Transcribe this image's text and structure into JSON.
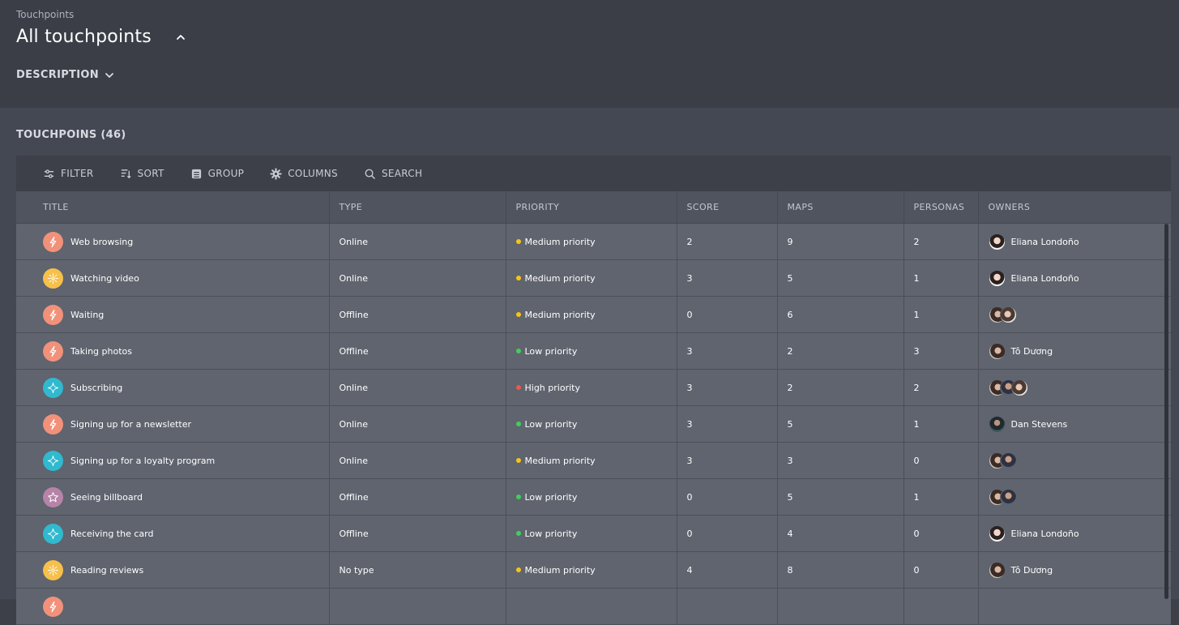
{
  "header": {
    "breadcrumb": "Touchpoints",
    "title": "All touchpoints",
    "description_label": "DESCRIPTION"
  },
  "section": {
    "title": "TOUCHPOINS (46)"
  },
  "toolbar": {
    "filter": "FILTER",
    "sort": "SORT",
    "group": "GROUP",
    "columns": "COLUMNS",
    "search": "SEARCH"
  },
  "columns": [
    "TITLE",
    "TYPE",
    "PRIORITY",
    "SCORE",
    "MAPS",
    "PERSONAS",
    "OWNERS"
  ],
  "priority_colors": {
    "Medium priority": "#f5c518",
    "Low priority": "#3fcf5b",
    "High priority": "#f0544f"
  },
  "icon_colors": {
    "lightning-icon": "#f2917a",
    "radial-icon": "#f7c04b",
    "sparkle-icon": "#30b9cf",
    "star-icon": "#b584a8"
  },
  "rows": [
    {
      "title": "Web browsing",
      "icon": "lightning-icon",
      "type": "Online",
      "priority": "Medium priority",
      "score": "2",
      "maps": "9",
      "personas": "2",
      "owners": [
        "avatar-a"
      ],
      "owner_name": "Eliana Londoño"
    },
    {
      "title": "Watching video",
      "icon": "radial-icon",
      "type": "Online",
      "priority": "Medium priority",
      "score": "3",
      "maps": "5",
      "personas": "1",
      "owners": [
        "avatar-a"
      ],
      "owner_name": "Eliana Londoño"
    },
    {
      "title": "Waiting",
      "icon": "lightning-icon",
      "type": "Offline",
      "priority": "Medium priority",
      "score": "0",
      "maps": "6",
      "personas": "1",
      "owners": [
        "avatar-b",
        "avatar-c"
      ],
      "owner_name": ""
    },
    {
      "title": "Taking photos",
      "icon": "lightning-icon",
      "type": "Offline",
      "priority": "Low priority",
      "score": "3",
      "maps": "2",
      "personas": "3",
      "owners": [
        "avatar-b"
      ],
      "owner_name": "Tô Dương"
    },
    {
      "title": "Subscribing",
      "icon": "sparkle-icon",
      "type": "Online",
      "priority": "High priority",
      "score": "3",
      "maps": "2",
      "personas": "2",
      "owners": [
        "avatar-b",
        "avatar-d",
        "avatar-c"
      ],
      "owner_name": ""
    },
    {
      "title": "Signing up for a newsletter",
      "icon": "lightning-icon",
      "type": "Online",
      "priority": "Low priority",
      "score": "3",
      "maps": "5",
      "personas": "1",
      "owners": [
        "avatar-e"
      ],
      "owner_name": "Dan Stevens"
    },
    {
      "title": "Signing up for a loyalty program",
      "icon": "sparkle-icon",
      "type": "Online",
      "priority": "Medium priority",
      "score": "3",
      "maps": "3",
      "personas": "0",
      "owners": [
        "avatar-b",
        "avatar-d"
      ],
      "owner_name": ""
    },
    {
      "title": "Seeing billboard",
      "icon": "star-icon",
      "type": "Offline",
      "priority": "Low priority",
      "score": "0",
      "maps": "5",
      "personas": "1",
      "owners": [
        "avatar-b",
        "avatar-d"
      ],
      "owner_name": ""
    },
    {
      "title": "Receiving the card",
      "icon": "sparkle-icon",
      "type": "Offline",
      "priority": "Low priority",
      "score": "0",
      "maps": "4",
      "personas": "0",
      "owners": [
        "avatar-a"
      ],
      "owner_name": "Eliana Londoño"
    },
    {
      "title": "Reading reviews",
      "icon": "radial-icon",
      "type": "No type",
      "priority": "Medium priority",
      "score": "4",
      "maps": "8",
      "personas": "0",
      "owners": [
        "avatar-b"
      ],
      "owner_name": "Tô Dương"
    },
    {
      "title": "",
      "icon": "lightning-icon",
      "type": "",
      "priority": "",
      "score": "",
      "maps": "",
      "personas": "",
      "owners": [],
      "owner_name": ""
    }
  ]
}
